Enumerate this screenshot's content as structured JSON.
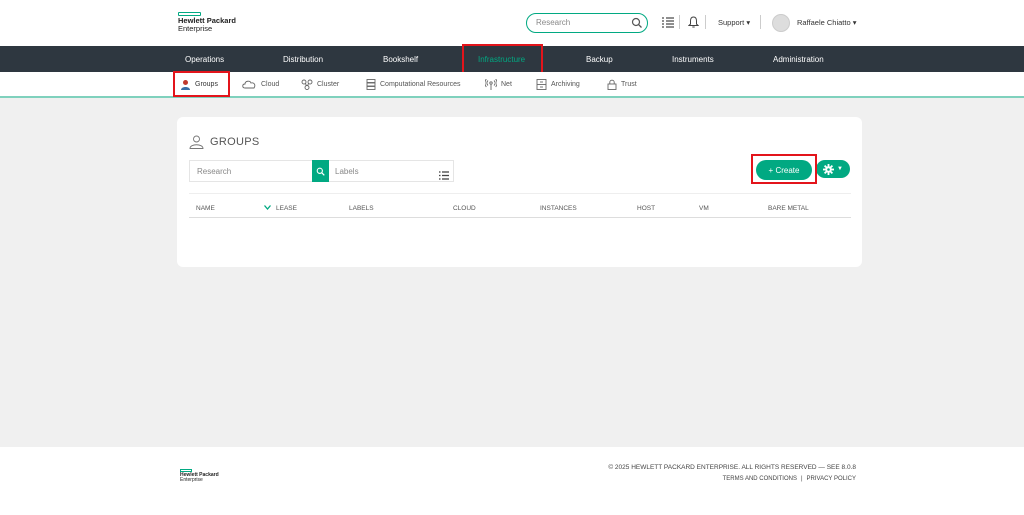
{
  "header": {
    "logo_line1": "Hewlett Packard",
    "logo_line2": "Enterprise",
    "search_placeholder": "Research",
    "support_label": "Support",
    "user_name": "Raffaele Chiatto"
  },
  "main_nav": {
    "items": [
      {
        "label": "Operations"
      },
      {
        "label": "Distribution"
      },
      {
        "label": "Bookshelf"
      },
      {
        "label": "Infrastructure",
        "active": true
      },
      {
        "label": "Backup"
      },
      {
        "label": "Instruments"
      },
      {
        "label": "Administration"
      }
    ]
  },
  "sub_nav": {
    "items": [
      {
        "label": "Groups",
        "icon": "groups-icon",
        "active": true
      },
      {
        "label": "Cloud",
        "icon": "cloud-icon"
      },
      {
        "label": "Cluster",
        "icon": "cluster-icon"
      },
      {
        "label": "Computational Resources",
        "icon": "server-icon"
      },
      {
        "label": "Net",
        "icon": "network-icon"
      },
      {
        "label": "Archiving",
        "icon": "archive-icon"
      },
      {
        "label": "Trust",
        "icon": "lock-icon"
      }
    ]
  },
  "groups": {
    "title": "GROUPS",
    "search_placeholder": "Research",
    "labels_placeholder": "Labels",
    "create_label": "+ Create",
    "columns": [
      "NAME",
      "LEASE",
      "LABELS",
      "CLOUD",
      "INSTANCES",
      "HOST",
      "VM",
      "BARE METAL"
    ],
    "rows": []
  },
  "footer": {
    "logo_line1": "Hewlett Packard",
    "logo_line2": "Enterprise",
    "copyright": "© 2025 HEWLETT PACKARD ENTERPRISE. ALL RIGHTS RESERVED — SEE 8.0.8",
    "terms": "TERMS AND CONDITIONS",
    "separator": "|",
    "privacy": "PRIVACY POLICY"
  },
  "colors": {
    "accent": "#01a982",
    "nav_bg": "#2e3740",
    "highlight": "#e3141b"
  }
}
